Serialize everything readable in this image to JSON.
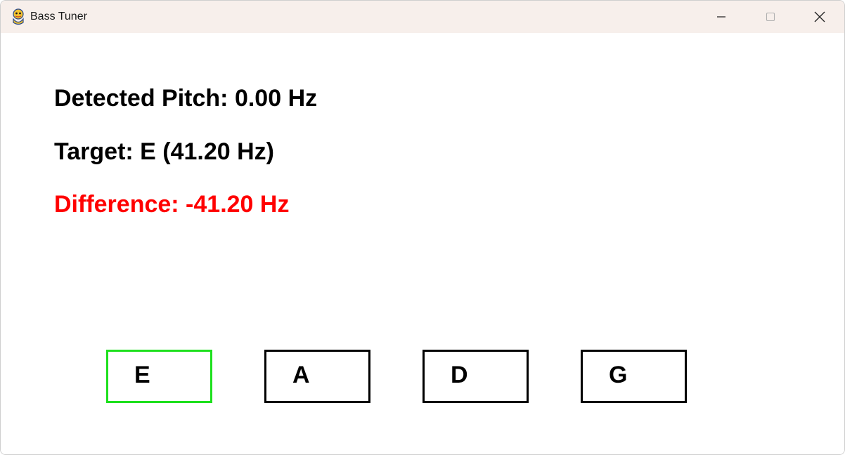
{
  "window": {
    "title": "Bass Tuner",
    "icon": "pygame-snake-icon",
    "controls": [
      "minimize-icon",
      "maximize-icon",
      "close-icon"
    ]
  },
  "readouts": {
    "detected_pitch": "Detected Pitch: 0.00 Hz",
    "target": "Target: E (41.20 Hz)",
    "difference": "Difference: -41.20 Hz",
    "difference_color": "#ff0000"
  },
  "strings": [
    {
      "label": "E",
      "selected": true
    },
    {
      "label": "A",
      "selected": false
    },
    {
      "label": "D",
      "selected": false
    },
    {
      "label": "G",
      "selected": false
    }
  ],
  "colors": {
    "titlebar_bg": "#f7efeb",
    "selected_border": "#1ee01e",
    "default_border": "#000000",
    "text": "#000000"
  }
}
